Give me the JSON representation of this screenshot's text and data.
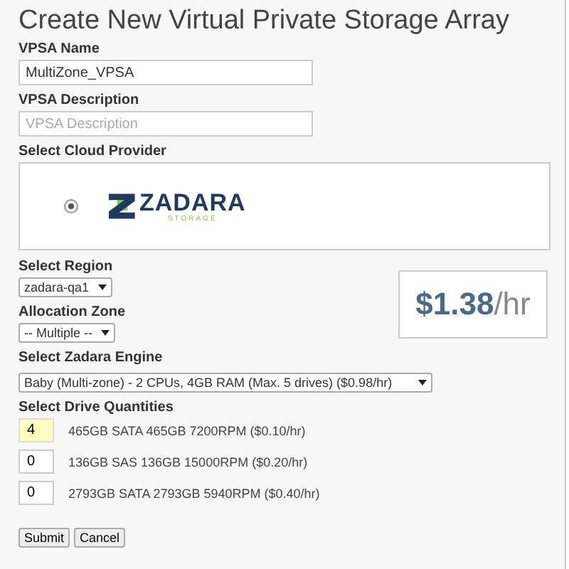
{
  "title": "Create New Virtual Private Storage Array",
  "name_field": {
    "label": "VPSA Name",
    "value": "MultiZone_VPSA"
  },
  "description_field": {
    "label": "VPSA Description",
    "placeholder": "VPSA Description"
  },
  "cloud_provider": {
    "label": "Select Cloud Provider",
    "options": [
      {
        "logo_name": "ZADARA",
        "logo_sub": "STORAGE",
        "selected": true
      }
    ]
  },
  "region": {
    "label": "Select Region",
    "value": "zadara-qa1"
  },
  "allocation_zone": {
    "label": "Allocation Zone",
    "value": "-- Multiple --"
  },
  "engine": {
    "label": "Select Zadara Engine",
    "value": "Baby (Multi-zone) - 2 CPUs, 4GB RAM (Max. 5 drives) ($0.98/hr)"
  },
  "price": {
    "amount": "$1.38",
    "unit": "/hr"
  },
  "drives": {
    "label": "Select Drive Quantities",
    "rows": [
      {
        "quantity": "4",
        "description": "465GB SATA 465GB 7200RPM ($0.10/hr)",
        "focused": true
      },
      {
        "quantity": "0",
        "description": "136GB SAS 136GB 15000RPM ($0.20/hr)",
        "focused": false
      },
      {
        "quantity": "0",
        "description": "2793GB SATA 2793GB 5940RPM ($0.40/hr)",
        "focused": false
      }
    ]
  },
  "buttons": [
    "Submit",
    "Cancel"
  ]
}
